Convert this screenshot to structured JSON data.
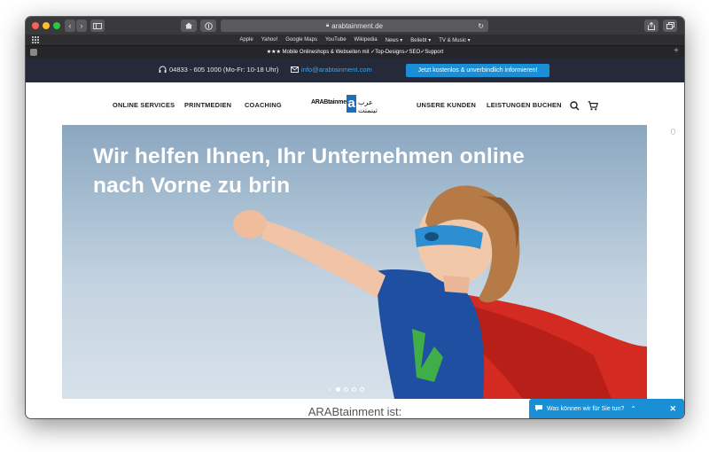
{
  "browser": {
    "url": "arabtainment.de",
    "favorites": [
      "Apple",
      "Yahoo!",
      "Google Maps",
      "YouTube",
      "Wikipedia",
      "News ▾",
      "Beliebt ▾",
      "TV & Music ▾"
    ],
    "tab_title": "★★★ Mobile Onlineshops & Webseiten mit ✓Top-Designs✓SEO✓Support"
  },
  "topbar": {
    "phone": "04833 - 605 1000 (Mo-Fr: 10-18 Uhr)",
    "email": "info@arabtainment.com",
    "cta": "Jetzt kostenlos & unverbindlich informieren!"
  },
  "nav": {
    "items_left": [
      "ONLINE SERVICES",
      "PRINTMEDIEN",
      "COACHING"
    ],
    "items_right": [
      "UNSERE KUNDEN",
      "LEISTUNGEN BUCHEN"
    ],
    "logo_text": "ARABtainment",
    "logo_letter": "a",
    "logo_arabic": "عرب تينمنت"
  },
  "hero": {
    "headline_line1": "Wir helfen Ihnen, Ihr Unternehmen online",
    "headline_line2": "nach Vorne zu brin",
    "slide_count": 4,
    "active_slide": 1
  },
  "main": {
    "subheading": "ARABtainment ist:"
  },
  "chat": {
    "label": "Was können wir für Sie tun?"
  },
  "colors": {
    "accent": "#1b8fd6",
    "topbar_bg": "#252a3a"
  }
}
